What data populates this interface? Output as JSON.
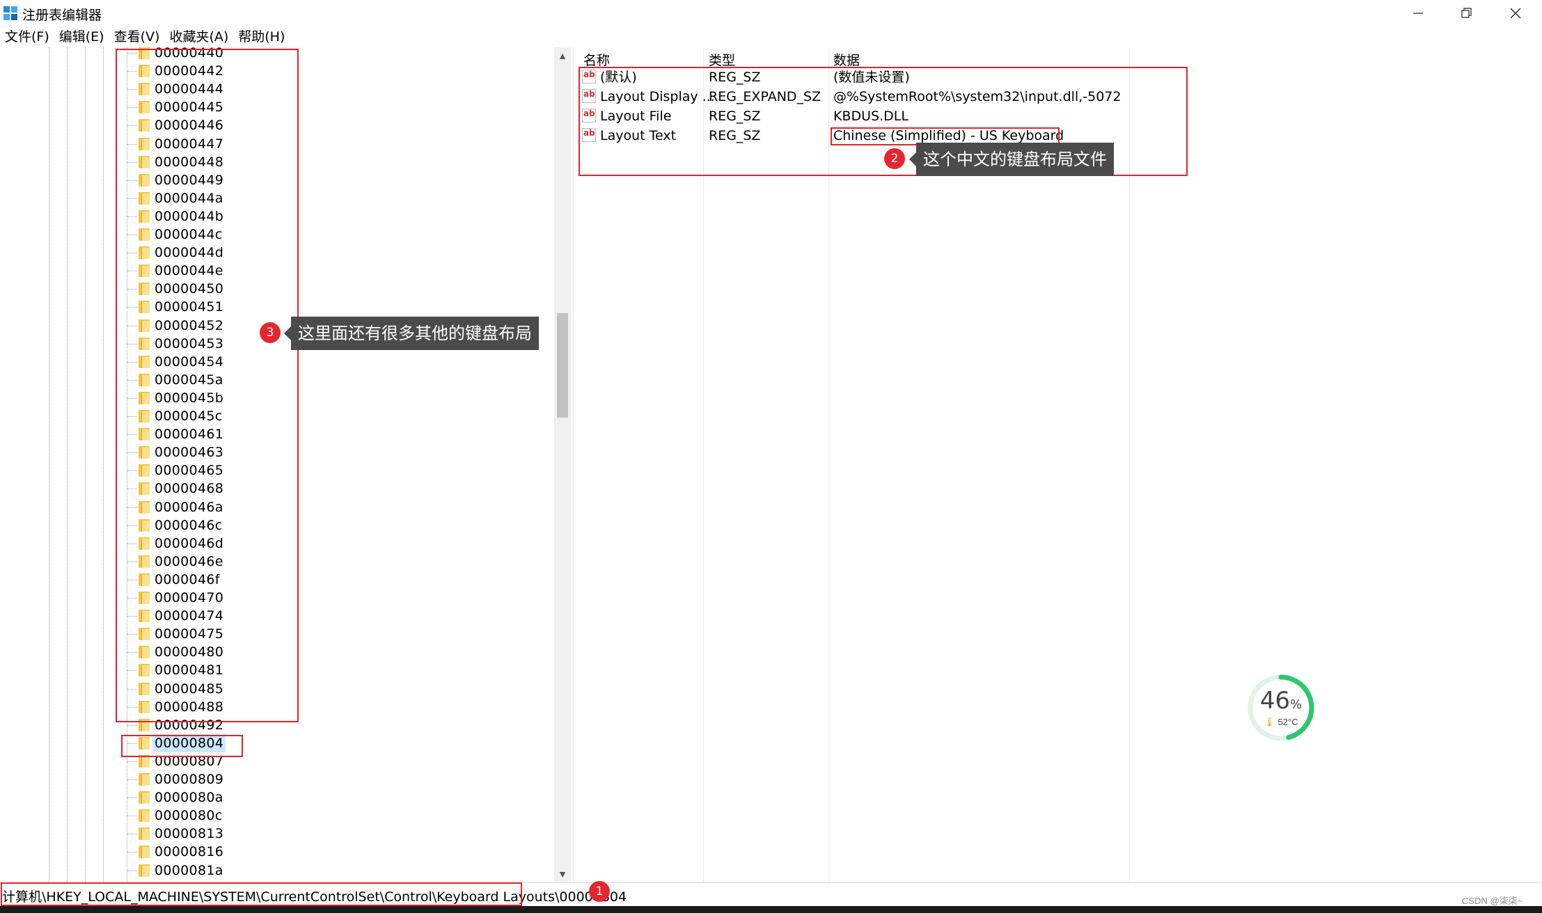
{
  "window": {
    "title": "注册表编辑器"
  },
  "menu": [
    "文件(F)",
    "编辑(E)",
    "查看(V)",
    "收藏夹(A)",
    "帮助(H)"
  ],
  "tree": {
    "items": [
      "00000440",
      "00000442",
      "00000444",
      "00000445",
      "00000446",
      "00000447",
      "00000448",
      "00000449",
      "0000044a",
      "0000044b",
      "0000044c",
      "0000044d",
      "0000044e",
      "00000450",
      "00000451",
      "00000452",
      "00000453",
      "00000454",
      "0000045a",
      "0000045b",
      "0000045c",
      "00000461",
      "00000463",
      "00000465",
      "00000468",
      "0000046a",
      "0000046c",
      "0000046d",
      "0000046e",
      "0000046f",
      "00000470",
      "00000474",
      "00000475",
      "00000480",
      "00000481",
      "00000485",
      "00000488",
      "00000492",
      "00000804",
      "00000807",
      "00000809",
      "0000080a",
      "0000080c",
      "00000813",
      "00000816",
      "0000081a"
    ],
    "selected": "00000804"
  },
  "list": {
    "headers": {
      "name": "名称",
      "type": "类型",
      "data": "数据"
    },
    "rows": [
      {
        "name": "(默认)",
        "type": "REG_SZ",
        "data": "(数值未设置)"
      },
      {
        "name": "Layout Display ...",
        "type": "REG_EXPAND_SZ",
        "data": "@%SystemRoot%\\system32\\input.dll,-5072"
      },
      {
        "name": "Layout File",
        "type": "REG_SZ",
        "data": "KBDUS.DLL"
      },
      {
        "name": "Layout Text",
        "type": "REG_SZ",
        "data": "Chinese (Simplified) - US Keyboard"
      }
    ]
  },
  "status": {
    "path": "计算机\\HKEY_LOCAL_MACHINE\\SYSTEM\\CurrentControlSet\\Control\\Keyboard Layouts\\00000804"
  },
  "annotations": {
    "badge1": "1",
    "badge2": "2",
    "badge3": "3",
    "callout2": "这个中文的键盘布局文件",
    "callout3": "这里面还有很多其他的键盘布局",
    "color": "#e3222b"
  },
  "widget": {
    "percent": "46",
    "percent_sign": "%",
    "temp": "52°C",
    "value": 0.46,
    "ring_color": "#2ec76e"
  },
  "watermark": "CSDN @柒柒~"
}
